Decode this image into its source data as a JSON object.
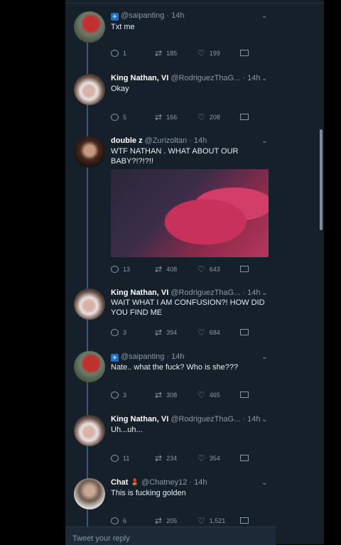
{
  "tweets": [
    {
      "name": "",
      "handle": "@saipanting",
      "time": "14h",
      "text": "Txt me",
      "replies": "1",
      "retweets": "185",
      "likes": "199",
      "avatar": "red-tinted-avatar"
    },
    {
      "name": "King Nathan, VI",
      "handle": "@RodriguezThaG...",
      "time": "14h",
      "text": "Okay",
      "replies": "5",
      "retweets": "166",
      "likes": "208",
      "avatar": "man-avatar"
    },
    {
      "name": "double z",
      "handle": "@Zurizoltan",
      "time": "14h",
      "text": "WTF NATHAN . WHAT ABOUT OUR BABY?!?!?!!",
      "replies": "13",
      "retweets": "408",
      "likes": "643",
      "avatar": "girl-avatar",
      "has_media": true
    },
    {
      "name": "King Nathan, VI",
      "handle": "@RodriguezThaG...",
      "time": "14h",
      "text": "WAIT WHAT I AM CONFUSION?! HOW DID YOU FIND ME",
      "replies": "3",
      "retweets": "394",
      "likes": "684",
      "avatar": "man-avatar"
    },
    {
      "name": "",
      "handle": "@saipanting",
      "time": "14h",
      "text": "Nate.. what the fuck? Who is she???",
      "replies": "3",
      "retweets": "308",
      "likes": "465",
      "avatar": "red-tinted-avatar"
    },
    {
      "name": "King Nathan, VI",
      "handle": "@RodriguezThaG...",
      "time": "14h",
      "text": "Uh...uh...",
      "replies": "11",
      "retweets": "234",
      "likes": "354",
      "avatar": "man-avatar"
    },
    {
      "name": "Chat",
      "handle": "@Chatney12",
      "time": "14h",
      "text": "This is fucking golden",
      "replies": "6",
      "retweets": "205",
      "likes": "1,521",
      "avatar": "chat-avatar"
    }
  ],
  "composer": {
    "placeholder": "Tweet your reply"
  },
  "icons": {
    "reply": "reply-icon",
    "retweet": "retweet-icon",
    "like": "heart-icon",
    "dm": "envelope-icon",
    "more": "chevron-down-icon"
  },
  "colors": {
    "background": "#15202b",
    "text": "#e6ecf0",
    "muted": "#8899a6",
    "thread_line": "#3a5a78"
  }
}
